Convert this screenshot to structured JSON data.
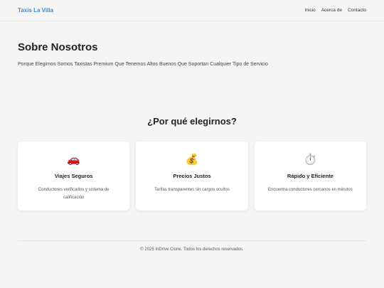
{
  "nav": {
    "brand": "Taxis La Villa",
    "links": [
      "Inicio",
      "Acerca de",
      "Contacto"
    ]
  },
  "about": {
    "title": "Sobre Nosotros",
    "text": "Porque Elegirnos Somos Taxistas Premium Que Tenemos Altos Buenos Que Soportan Cualquier Tipo de Servicio"
  },
  "why": {
    "title": "¿Por qué elegirnos?",
    "cards": [
      {
        "icon": "🚗",
        "icon_name": "car-icon",
        "title": "Viajes Seguros",
        "text": "Conductores verificados y sistema de calificación"
      },
      {
        "icon": "💰",
        "icon_name": "money-bag-icon",
        "title": "Precios Justos",
        "text": "Tarifas transparentes sin cargos ocultos"
      },
      {
        "icon": "⏱️",
        "icon_name": "stopwatch-icon",
        "title": "Rápido y Eficiente",
        "text": "Encuentra conductores cercanos en minutos"
      }
    ]
  },
  "footer": {
    "text": "© 2025 InDrive Clone. Todos los derechos reservados."
  },
  "colors": {
    "brand": "#3a8ad6",
    "background": "#f5f5f5"
  }
}
